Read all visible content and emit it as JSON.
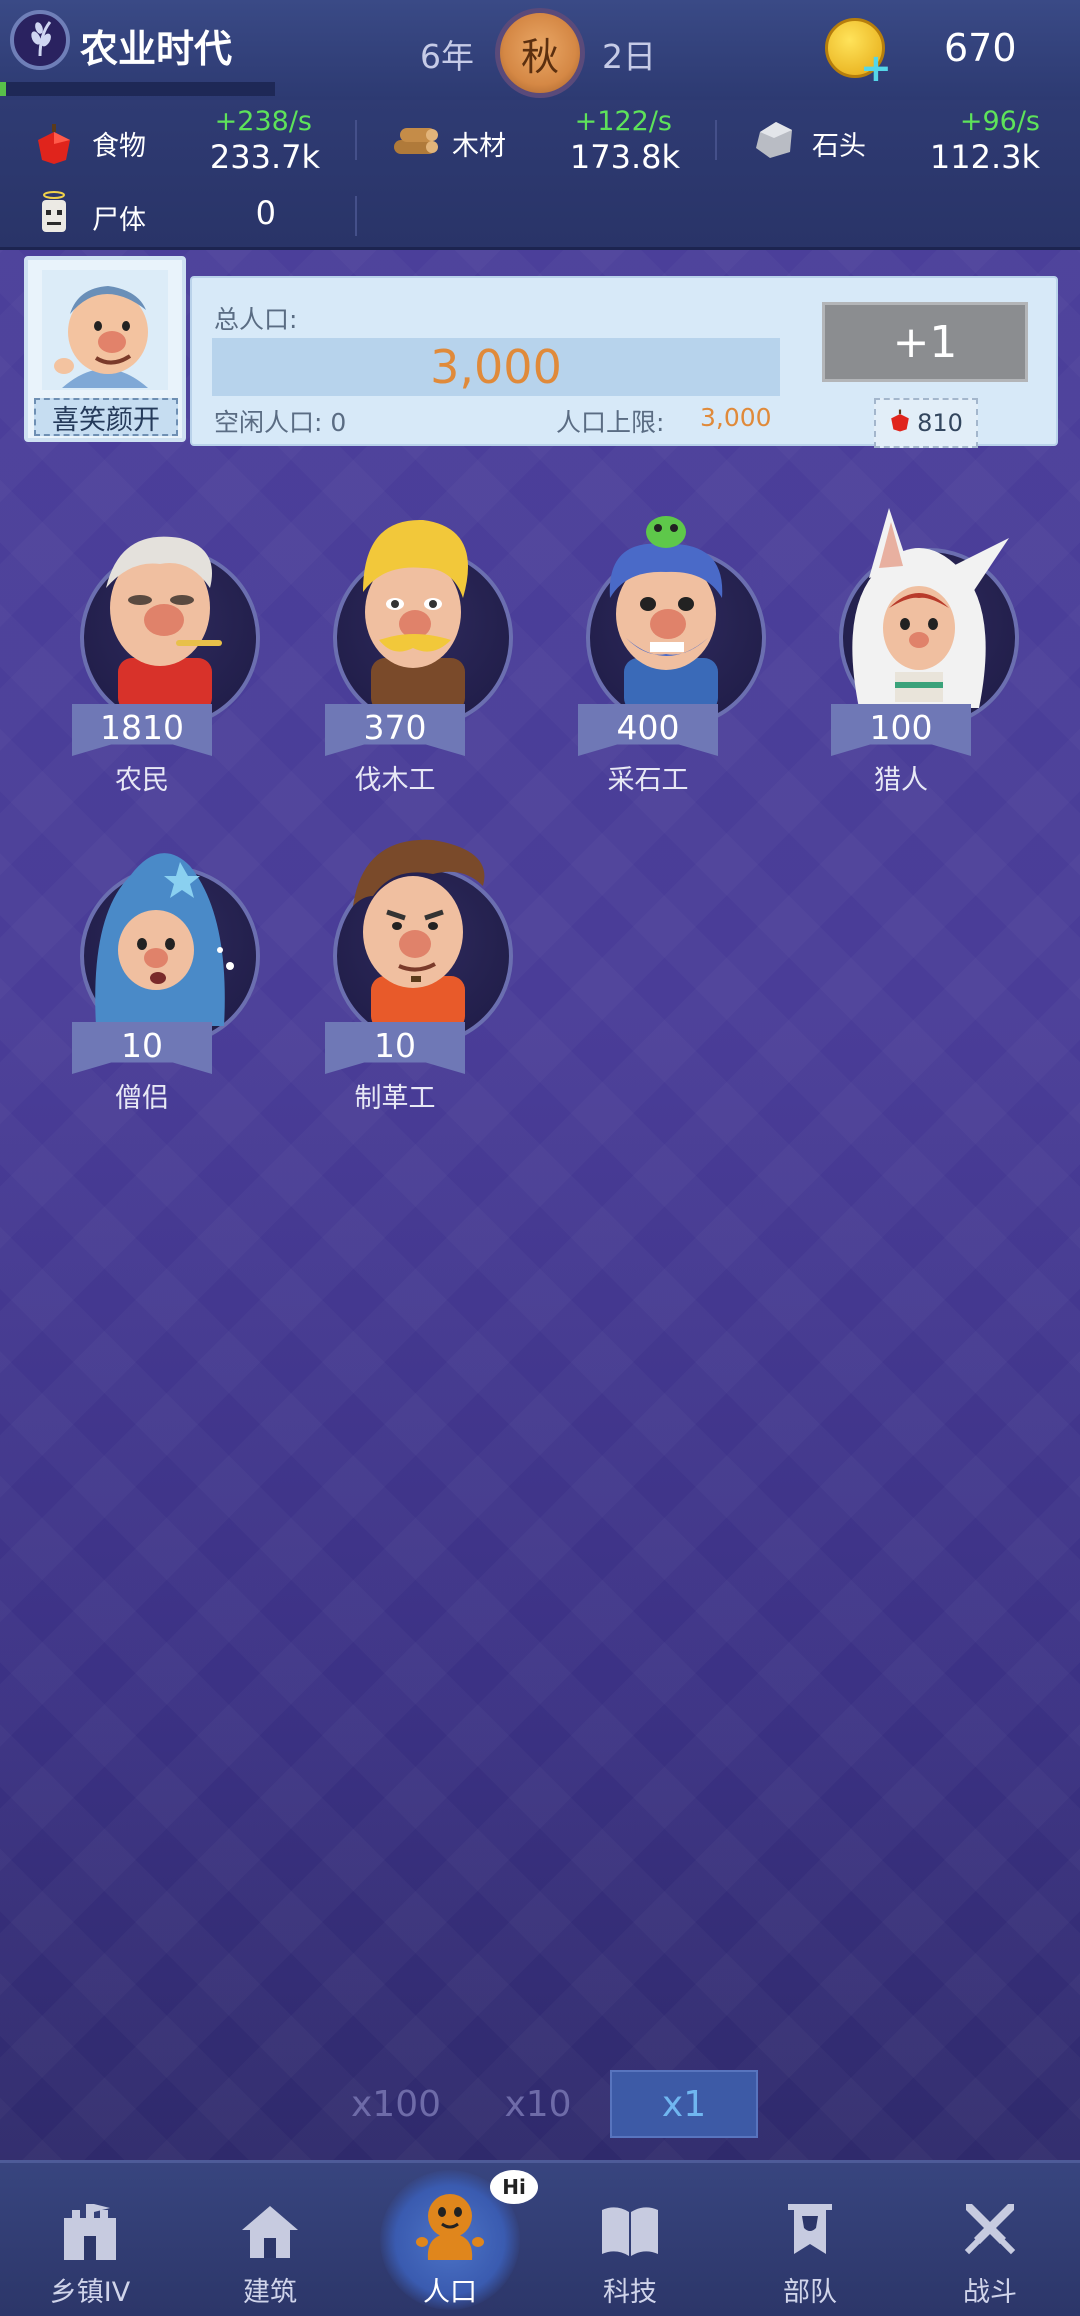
{
  "header": {
    "era_title": "农业时代",
    "era_progress": 0.02,
    "year": "6年",
    "season": "秋",
    "day": "2日",
    "gold": "670"
  },
  "resources": [
    {
      "name": "食物",
      "rate": "+238/s",
      "amount": "233.7k",
      "icon": "apple-icon"
    },
    {
      "name": "木材",
      "rate": "+122/s",
      "amount": "173.8k",
      "icon": "wood-logs-icon"
    },
    {
      "name": "石头",
      "rate": "+96/s",
      "amount": "112.3k",
      "icon": "stone-icon"
    },
    {
      "name": "尸体",
      "rate": "",
      "amount": "0",
      "icon": "skull-icon"
    }
  ],
  "population": {
    "mood": "喜笑颜开",
    "total_label": "总人口:",
    "total": "3,000",
    "idle_label": "空闲人口:",
    "idle": "0",
    "cap_label": "人口上限:",
    "cap": "3,000",
    "add_button": "+1",
    "add_cost": "810"
  },
  "workers": [
    {
      "name": "农民",
      "count": "1810"
    },
    {
      "name": "伐木工",
      "count": "370"
    },
    {
      "name": "采石工",
      "count": "400"
    },
    {
      "name": "猎人",
      "count": "100"
    },
    {
      "name": "僧侣",
      "count": "10"
    },
    {
      "name": "制革工",
      "count": "10"
    }
  ],
  "multipliers": {
    "options": [
      "x100",
      "x10",
      "x1"
    ],
    "selected": "x1"
  },
  "nav": {
    "items": [
      {
        "label": "乡镇IV",
        "icon": "castle-icon"
      },
      {
        "label": "建筑",
        "icon": "house-icon"
      },
      {
        "label": "人口",
        "icon": "population-mascot-icon"
      },
      {
        "label": "科技",
        "icon": "book-icon"
      },
      {
        "label": "部队",
        "icon": "banner-icon"
      },
      {
        "label": "战斗",
        "icon": "crossed-swords-icon"
      }
    ],
    "active": "人口",
    "badge": "Hi"
  }
}
